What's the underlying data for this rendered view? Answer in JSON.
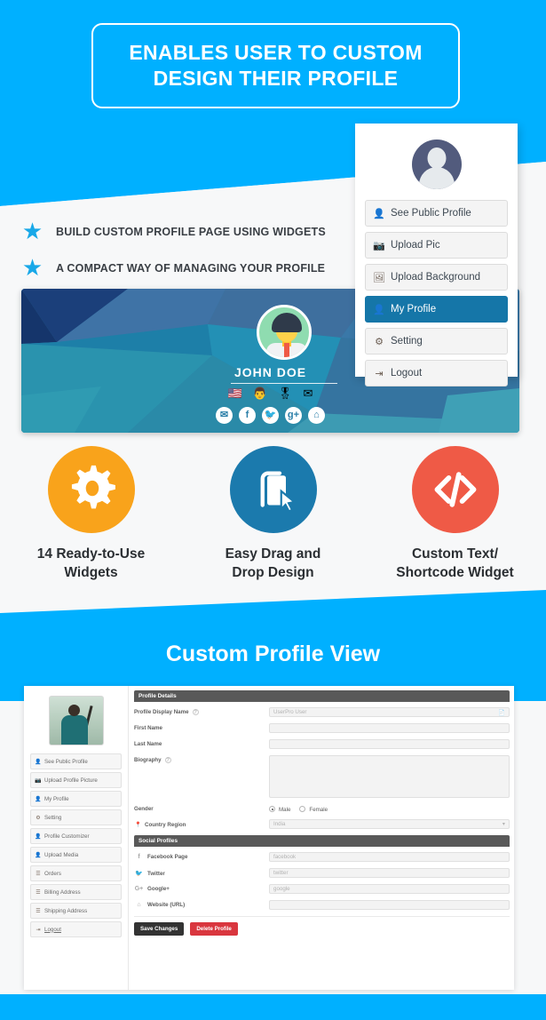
{
  "hero": {
    "line1": "ENABLES USER TO CUSTOM",
    "line2": "DESIGN THEIR PROFILE"
  },
  "colors": {
    "brand_blue": "#00b0ff",
    "active_blue": "#1576a8",
    "gear_orange": "#f9a31b",
    "drag_blue": "#1b7aad",
    "code_red": "#ef5a46",
    "light_bg": "#f7f8f9",
    "save_dark": "#333333",
    "delete_red": "#d9363e"
  },
  "bullets": [
    {
      "icon": "star-icon",
      "label": "BUILD CUSTOM PROFILE PAGE USING WIDGETS"
    },
    {
      "icon": "star-icon",
      "label": "A COMPACT WAY OF MANAGING YOUR PROFILE"
    }
  ],
  "menu_panel": {
    "avatar": "user-avatar-placeholder",
    "items": [
      {
        "icon": "user-icon",
        "label": "See Public Profile",
        "active": false
      },
      {
        "icon": "camera-icon",
        "label": "Upload Pic",
        "active": false
      },
      {
        "icon": "image-icon",
        "label": "Upload Background",
        "active": false
      },
      {
        "icon": "user-icon",
        "label": "My Profile",
        "active": true
      },
      {
        "icon": "gear-icon",
        "label": "Setting",
        "active": false
      },
      {
        "icon": "logout-icon",
        "label": "Logout",
        "active": false
      }
    ]
  },
  "banner": {
    "name": "JOHN DOE",
    "badges": [
      "flag-icon",
      "person-icon",
      "award-icon",
      "envelope-icon"
    ],
    "socials": [
      "email-icon",
      "facebook-icon",
      "twitter-icon",
      "googleplus-icon",
      "home-icon"
    ]
  },
  "features": [
    {
      "icon": "gear-icon",
      "line1": "14 Ready-to-Use",
      "line2": "Widgets"
    },
    {
      "icon": "drag-drop-icon",
      "line1": "Easy Drag and",
      "line2": "Drop Design"
    },
    {
      "icon": "code-icon",
      "line1": "Custom Text/",
      "line2": "Shortcode Widget"
    }
  ],
  "section_title": "Custom Profile View",
  "screenshot": {
    "sidebar": {
      "photo": "user-photo",
      "items": [
        {
          "icon": "user-icon",
          "label": "See Public Profile"
        },
        {
          "icon": "camera-icon",
          "label": "Upload Profile Picture"
        },
        {
          "icon": "user-icon",
          "label": "My Profile"
        },
        {
          "icon": "gear-icon",
          "label": "Setting"
        },
        {
          "icon": "user-icon",
          "label": "Profile Customizer"
        },
        {
          "icon": "user-icon",
          "label": "Upload Media"
        },
        {
          "icon": "list-icon",
          "label": "Orders"
        },
        {
          "icon": "list-icon",
          "label": "Billing Address"
        },
        {
          "icon": "list-icon",
          "label": "Shipping Address"
        },
        {
          "icon": "logout-icon",
          "label": "Logout"
        }
      ]
    },
    "profile_details": {
      "title": "Profile Details",
      "fields": [
        {
          "label": "Profile Display Name",
          "help": true,
          "value": "UserPro User",
          "type": "text",
          "trailing_icon": "id-card-icon"
        },
        {
          "label": "First Name",
          "help": false,
          "value": "",
          "type": "text"
        },
        {
          "label": "Last Name",
          "help": false,
          "value": "",
          "type": "text"
        },
        {
          "label": "Biography",
          "help": true,
          "value": "",
          "type": "textarea"
        }
      ],
      "gender": {
        "label": "Gender",
        "options": [
          "Male",
          "Female"
        ],
        "selected": "Male"
      },
      "country": {
        "label": "Country Region",
        "icon": "map-pin-icon",
        "value": "India"
      }
    },
    "social_profiles": {
      "title": "Social Profiles",
      "fields": [
        {
          "icon": "facebook-icon",
          "label": "Facebook Page",
          "placeholder": "facebook"
        },
        {
          "icon": "twitter-icon",
          "label": "Twitter",
          "placeholder": "twitter"
        },
        {
          "icon": "googleplus-icon",
          "label": "Google+",
          "placeholder": "google"
        },
        {
          "icon": "home-icon",
          "label": "Website (URL)",
          "placeholder": ""
        }
      ]
    },
    "buttons": [
      {
        "label": "Save Changes",
        "style": "dark"
      },
      {
        "label": "Delete Profile",
        "style": "red"
      }
    ]
  }
}
